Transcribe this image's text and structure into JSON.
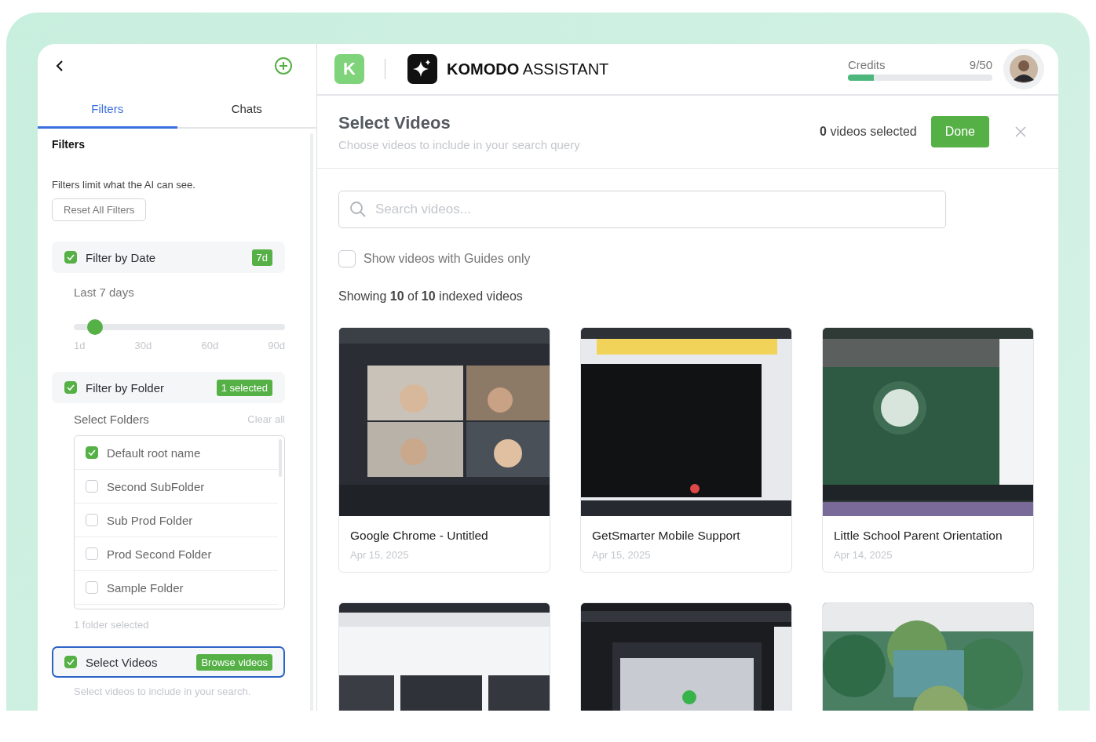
{
  "sidebar": {
    "tabs": [
      {
        "label": "Filters",
        "selected": true
      },
      {
        "label": "Chats",
        "selected": false
      }
    ],
    "heading": "Filters",
    "description": "Filters limit what the AI can see.",
    "reset_button": "Reset All Filters",
    "filters": [
      {
        "kind": "date",
        "label": "Filter by Date",
        "checked": true,
        "highlighted": false,
        "badge": "7d",
        "value_label": "Last 7 days",
        "level": 0.1,
        "ticks": [
          "1d",
          "30d",
          "60d",
          "90d"
        ]
      },
      {
        "kind": "folder",
        "label": "Filter by Folder",
        "checked": true,
        "highlighted": false,
        "badge": "1 selected",
        "subheading": "Select Folders",
        "clear_label": "Clear all",
        "folders": [
          {
            "name": "Default root name",
            "checked": true
          },
          {
            "name": "Second SubFolder",
            "checked": false
          },
          {
            "name": "Sub Prod Folder",
            "checked": false
          },
          {
            "name": "Prod Second Folder",
            "checked": false
          },
          {
            "name": "Sample Folder",
            "checked": false
          }
        ],
        "summary": "1 folder selected"
      },
      {
        "kind": "videos",
        "label": "Select Videos",
        "checked": true,
        "highlighted": true,
        "button": "Browse videos",
        "hint": "Select videos to include in your search."
      }
    ]
  },
  "header": {
    "logo_letter": "K",
    "brand_bold": "KOMODO",
    "brand_light": "ASSISTANT",
    "credits_label": "Credits",
    "credits_value": "9/50",
    "credits": {
      "level": 0.18
    }
  },
  "dialog": {
    "title": "Select Videos",
    "subtitle": "Choose videos to include in your search query",
    "count": "0",
    "count_label": "videos selected",
    "done_button": "Done",
    "search_placeholder": "Search videos...",
    "guides_checkbox": {
      "label": "Show videos with Guides only",
      "checked": false
    },
    "showing": "Showing **10** of **10** indexed videos",
    "videos": [
      {
        "thumbnail": {
          "kind": "picture"
        },
        "title": "Google Chrome - Untitled",
        "date": "Apr 15, 2025"
      },
      {
        "thumbnail": {
          "kind": "picture"
        },
        "title": "GetSmarter Mobile Support",
        "date": "Apr 15, 2025"
      },
      {
        "thumbnail": {
          "kind": "picture"
        },
        "title": "Little School Parent Orientation",
        "date": "Apr 14, 2025"
      },
      {
        "thumbnail": {
          "kind": "picture"
        }
      },
      {
        "thumbnail": {
          "kind": "picture"
        }
      },
      {
        "thumbnail": {
          "kind": "picture"
        }
      }
    ]
  }
}
